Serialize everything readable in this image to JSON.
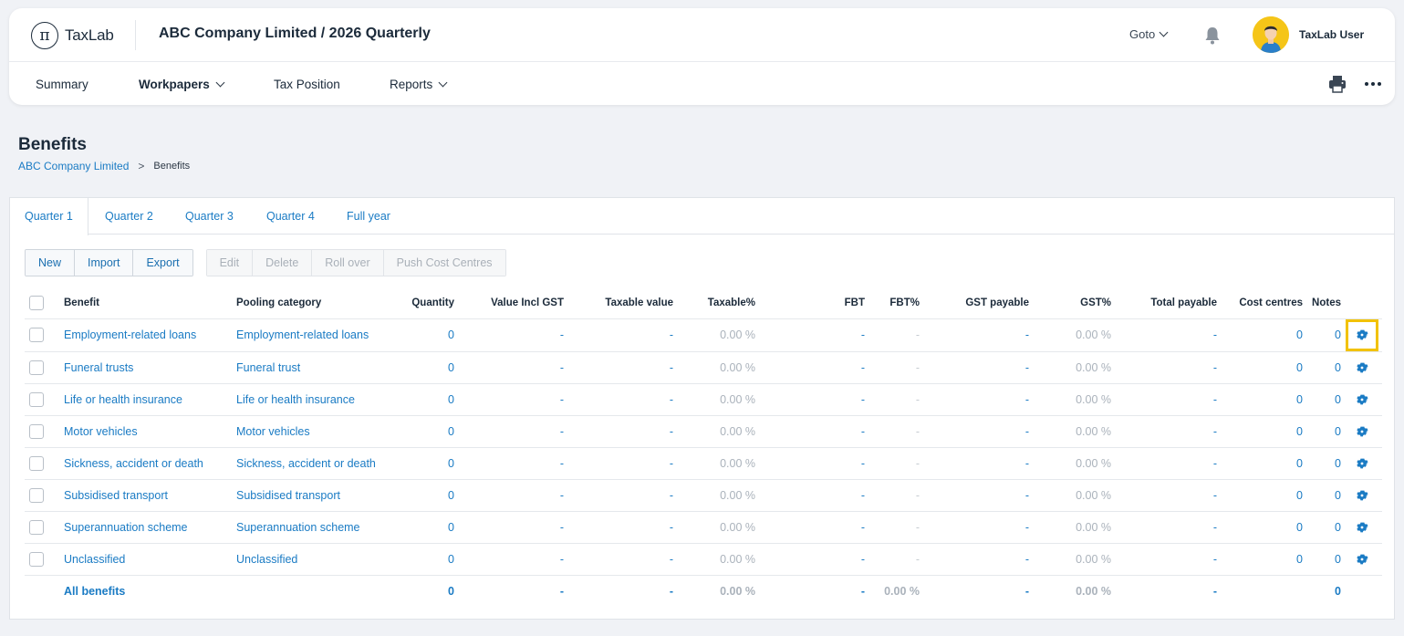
{
  "app": {
    "logo_text": "TaxLab",
    "logo_glyph": "π",
    "context_title": "ABC Company Limited / 2026 Quarterly",
    "goto_label": "Goto",
    "user_name": "TaxLab User",
    "icons": {
      "notifications": "bell-icon",
      "avatar": "user-avatar",
      "print": "printer-icon",
      "more": "more-horizontal-icon"
    }
  },
  "nav": {
    "items": [
      {
        "label": "Summary",
        "active": false,
        "has_dropdown": false
      },
      {
        "label": "Workpapers",
        "active": true,
        "has_dropdown": true
      },
      {
        "label": "Tax Position",
        "active": false,
        "has_dropdown": false
      },
      {
        "label": "Reports",
        "active": false,
        "has_dropdown": true
      }
    ]
  },
  "page": {
    "title": "Benefits",
    "breadcrumb": {
      "parent": "ABC Company Limited",
      "separator": ">",
      "current": "Benefits"
    }
  },
  "tabs": [
    {
      "label": "Quarter 1",
      "active": true
    },
    {
      "label": "Quarter 2",
      "active": false
    },
    {
      "label": "Quarter 3",
      "active": false
    },
    {
      "label": "Quarter 4",
      "active": false
    },
    {
      "label": "Full year",
      "active": false
    }
  ],
  "toolbar": {
    "primary": [
      "New",
      "Import",
      "Export"
    ],
    "disabled": [
      "Edit",
      "Delete",
      "Roll over",
      "Push Cost Centres"
    ]
  },
  "table": {
    "headers": [
      "Benefit",
      "Pooling category",
      "Quantity",
      "Value Incl GST",
      "Taxable value",
      "Taxable%",
      "FBT",
      "FBT%",
      "GST payable",
      "GST%",
      "Total payable",
      "Cost centres",
      "Notes"
    ],
    "rows": [
      {
        "benefit": "Employment-related loans",
        "pooling": "Employment-related loans",
        "quantity": "0",
        "value_incl_gst": "-",
        "taxable_value": "-",
        "taxable_pct": "0.00 %",
        "fbt": "-",
        "fbt_pct": "-",
        "gst_payable": "-",
        "gst_pct": "0.00 %",
        "total_payable": "-",
        "cost_centres": "0",
        "notes": "0",
        "highlighted": true
      },
      {
        "benefit": "Funeral trusts",
        "pooling": "Funeral trust",
        "quantity": "0",
        "value_incl_gst": "-",
        "taxable_value": "-",
        "taxable_pct": "0.00 %",
        "fbt": "-",
        "fbt_pct": "-",
        "gst_payable": "-",
        "gst_pct": "0.00 %",
        "total_payable": "-",
        "cost_centres": "0",
        "notes": "0",
        "highlighted": false
      },
      {
        "benefit": "Life or health insurance",
        "pooling": "Life or health insurance",
        "quantity": "0",
        "value_incl_gst": "-",
        "taxable_value": "-",
        "taxable_pct": "0.00 %",
        "fbt": "-",
        "fbt_pct": "-",
        "gst_payable": "-",
        "gst_pct": "0.00 %",
        "total_payable": "-",
        "cost_centres": "0",
        "notes": "0",
        "highlighted": false
      },
      {
        "benefit": "Motor vehicles",
        "pooling": "Motor vehicles",
        "quantity": "0",
        "value_incl_gst": "-",
        "taxable_value": "-",
        "taxable_pct": "0.00 %",
        "fbt": "-",
        "fbt_pct": "-",
        "gst_payable": "-",
        "gst_pct": "0.00 %",
        "total_payable": "-",
        "cost_centres": "0",
        "notes": "0",
        "highlighted": false
      },
      {
        "benefit": "Sickness, accident or death",
        "pooling": "Sickness, accident or death",
        "quantity": "0",
        "value_incl_gst": "-",
        "taxable_value": "-",
        "taxable_pct": "0.00 %",
        "fbt": "-",
        "fbt_pct": "-",
        "gst_payable": "-",
        "gst_pct": "0.00 %",
        "total_payable": "-",
        "cost_centres": "0",
        "notes": "0",
        "highlighted": false
      },
      {
        "benefit": "Subsidised transport",
        "pooling": "Subsidised transport",
        "quantity": "0",
        "value_incl_gst": "-",
        "taxable_value": "-",
        "taxable_pct": "0.00 %",
        "fbt": "-",
        "fbt_pct": "-",
        "gst_payable": "-",
        "gst_pct": "0.00 %",
        "total_payable": "-",
        "cost_centres": "0",
        "notes": "0",
        "highlighted": false
      },
      {
        "benefit": "Superannuation scheme",
        "pooling": "Superannuation scheme",
        "quantity": "0",
        "value_incl_gst": "-",
        "taxable_value": "-",
        "taxable_pct": "0.00 %",
        "fbt": "-",
        "fbt_pct": "-",
        "gst_payable": "-",
        "gst_pct": "0.00 %",
        "total_payable": "-",
        "cost_centres": "0",
        "notes": "0",
        "highlighted": false
      },
      {
        "benefit": "Unclassified",
        "pooling": "Unclassified",
        "quantity": "0",
        "value_incl_gst": "-",
        "taxable_value": "-",
        "taxable_pct": "0.00 %",
        "fbt": "-",
        "fbt_pct": "-",
        "gst_payable": "-",
        "gst_pct": "0.00 %",
        "total_payable": "-",
        "cost_centres": "0",
        "notes": "0",
        "highlighted": false
      }
    ],
    "total": {
      "label": "All benefits",
      "quantity": "0",
      "value_incl_gst": "-",
      "taxable_value": "-",
      "taxable_pct": "0.00 %",
      "fbt": "-",
      "fbt_pct": "0.00 %",
      "gst_payable": "-",
      "gst_pct": "0.00 %",
      "total_payable": "-",
      "notes": "0"
    }
  },
  "colors": {
    "link": "#1a7bc4",
    "highlight": "#f2c200",
    "muted": "#aab2bb",
    "page_bg": "#f0f2f6"
  }
}
